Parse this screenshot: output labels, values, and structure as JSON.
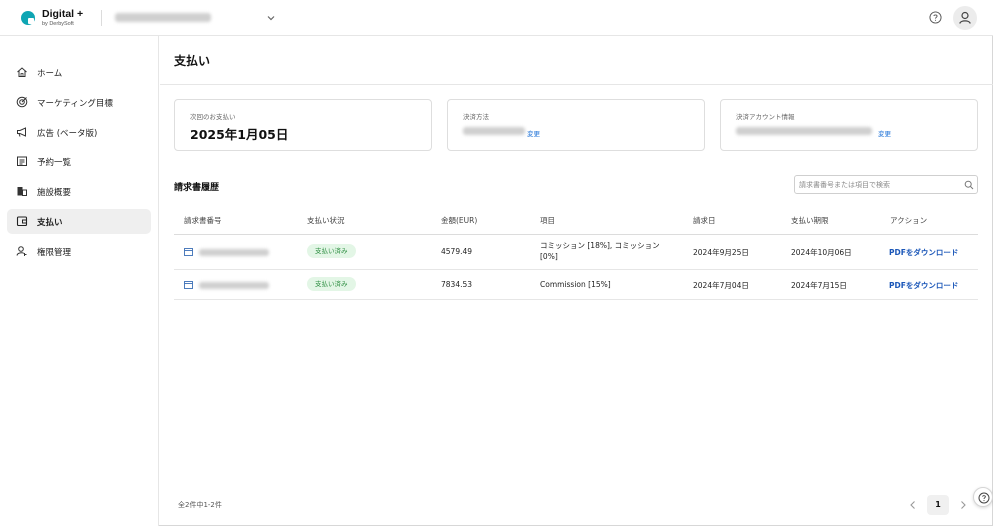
{
  "header": {
    "logo_title": "Digital +",
    "logo_subtitle": "by DerbySoft"
  },
  "sidebar": {
    "items": [
      {
        "label": "ホーム",
        "icon": "home-icon"
      },
      {
        "label": "マーケティング目標",
        "icon": "target-icon"
      },
      {
        "label": "広告 (ベータ版)",
        "icon": "megaphone-icon"
      },
      {
        "label": "予約一覧",
        "icon": "calendar-list-icon"
      },
      {
        "label": "施設概要",
        "icon": "building-icon"
      },
      {
        "label": "支払い",
        "icon": "wallet-icon",
        "active": true
      },
      {
        "label": "権限管理",
        "icon": "user-key-icon"
      }
    ]
  },
  "page": {
    "title": "支払い"
  },
  "cards": {
    "next_payment_label": "次回のお支払い",
    "next_payment_value": "2025年1月05日",
    "payment_method_label": "決済方法",
    "payment_method_change": "変更",
    "account_label": "決済アカウント情報",
    "account_change": "変更"
  },
  "invoices": {
    "title": "請求書履歴",
    "search_placeholder": "請求書番号または項目で検索",
    "columns": [
      "請求書番号",
      "支払い状況",
      "金額(EUR)",
      "項目",
      "請求日",
      "支払い期限",
      "アクション"
    ],
    "rows": [
      {
        "status": "支払い済み",
        "amount": "4579.49",
        "item": "コミッション [18%], コミッション [0%]",
        "invoice_date": "2024年9月25日",
        "due_date": "2024年10月06日",
        "action": "PDFをダウンロード"
      },
      {
        "status": "支払い済み",
        "amount": "7834.53",
        "item": "Commission [15%]",
        "invoice_date": "2024年7月04日",
        "due_date": "2024年7月15日",
        "action": "PDFをダウンロード"
      }
    ]
  },
  "footer": {
    "count_text": "全2件中1-2件",
    "current_page": "1"
  },
  "colors": {
    "accent": "#0ea5b3",
    "link": "#1a6fd6",
    "status_bg": "#e3f6e6",
    "status_text": "#2f8f43"
  }
}
